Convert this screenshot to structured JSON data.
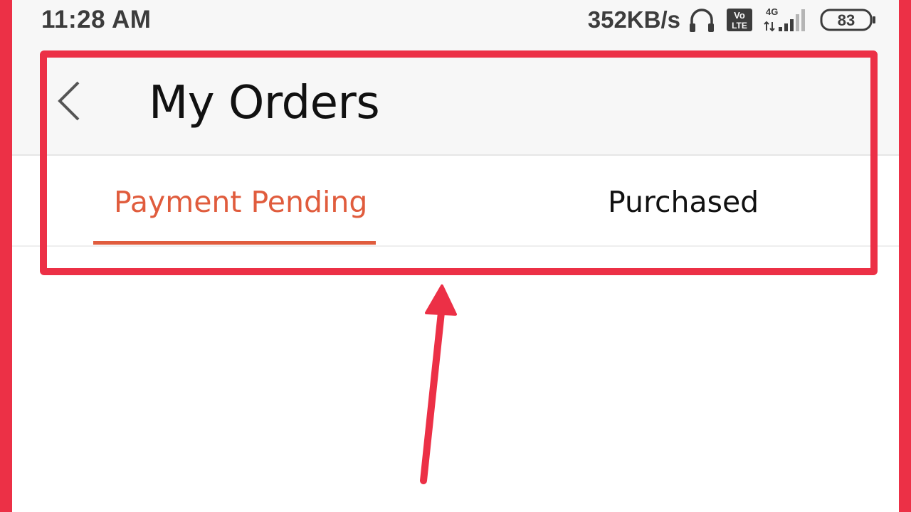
{
  "status_bar": {
    "time": "11:28 AM",
    "network_speed": "352KB/s",
    "volte_label_top": "Vo",
    "volte_label_bottom": "LTE",
    "network_type": "4G",
    "battery_level": "83",
    "icons": [
      "headphones-icon",
      "volte-icon",
      "signal-icon",
      "battery-icon"
    ]
  },
  "app_bar": {
    "back_icon": "chevron-left-icon",
    "title": "My Orders"
  },
  "tabs": [
    {
      "label": "Payment Pending",
      "active": true
    },
    {
      "label": "Purchased",
      "active": false
    }
  ],
  "annotation": {
    "highlight_color": "#ec3046",
    "arrow_icon": "arrow-up-icon"
  },
  "colors": {
    "accent": "#e05c3d",
    "annotation": "#ec3046",
    "title_text": "#111111"
  }
}
